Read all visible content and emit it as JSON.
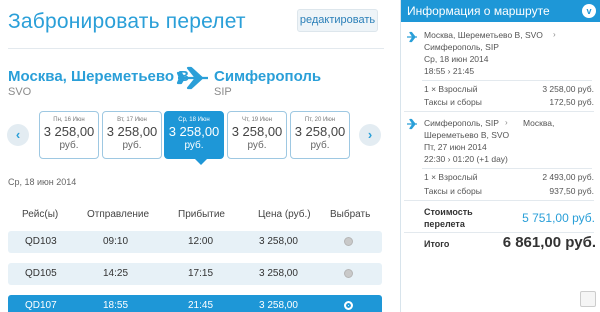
{
  "header": {
    "title": "Забронировать перелет",
    "edit_label": "редактировать"
  },
  "route": {
    "from_city": "Москва, Шереметьево B",
    "from_code": "SVO",
    "to_city": "Симферополь",
    "to_code": "SIP"
  },
  "calendar": {
    "prev_label": "‹",
    "next_label": "›",
    "days": [
      {
        "date": "Пн, 16 Июн",
        "price": "3 258,00",
        "currency": "руб."
      },
      {
        "date": "Вт, 17 Июн",
        "price": "3 258,00",
        "currency": "руб."
      },
      {
        "date": "Ср, 18 Июн",
        "price": "3 258,00",
        "currency": "руб.",
        "selected": true
      },
      {
        "date": "Чт, 19 Июн",
        "price": "3 258,00",
        "currency": "руб."
      },
      {
        "date": "Пт, 20 Июн",
        "price": "3 258,00",
        "currency": "руб."
      }
    ]
  },
  "selected_date": "Ср, 18 июн 2014",
  "flights": {
    "headers": [
      "Рейс(ы)",
      "Отправление",
      "Прибытие",
      "Цена (руб.)",
      "Выбрать"
    ],
    "rows": [
      {
        "flight": "QD103",
        "depart": "09:10",
        "arrive": "12:00",
        "price": "3 258,00",
        "selected": false
      },
      {
        "flight": "QD105",
        "depart": "14:25",
        "arrive": "17:15",
        "price": "3 258,00",
        "selected": false
      },
      {
        "flight": "QD107",
        "depart": "18:55",
        "arrive": "21:45",
        "price": "3 258,00",
        "selected": true
      }
    ]
  },
  "panel": {
    "title": "Информация о маршруте",
    "toggle_icon": "v",
    "outbound": {
      "route_line1": "Москва, Шереметьево B, SVO",
      "route_line2": "Симферополь, SIP",
      "date": "Ср, 18 июн 2014",
      "times": "18:55  ›  21:45",
      "passengers_label": "1 × Взрослый",
      "passengers_value": "3 258,00 руб.",
      "taxes_label": "Таксы и сборы",
      "taxes_value": "172,50 руб."
    },
    "inbound": {
      "route_line1": "Симферополь, SIP",
      "route_line1b": "Москва,",
      "route_line2": "Шереметьево B, SVO",
      "date": "Пт, 27 июн 2014",
      "times": "22:30  ›  01:20 (+1 day)",
      "passengers_label": "1 × Взрослый",
      "passengers_value": "2 493,00 руб.",
      "taxes_label": "Таксы и сборы",
      "taxes_value": "937,50 руб."
    },
    "cost_label_1": "Стоимость",
    "cost_label_2": "перелета",
    "cost_value": "5 751,00 руб.",
    "total_label": "Итого",
    "total_value": "6 861,00 руб."
  },
  "colors": {
    "accent": "#1e97d7",
    "title": "#2a9fd8",
    "row_bg": "#e7f1f7"
  }
}
